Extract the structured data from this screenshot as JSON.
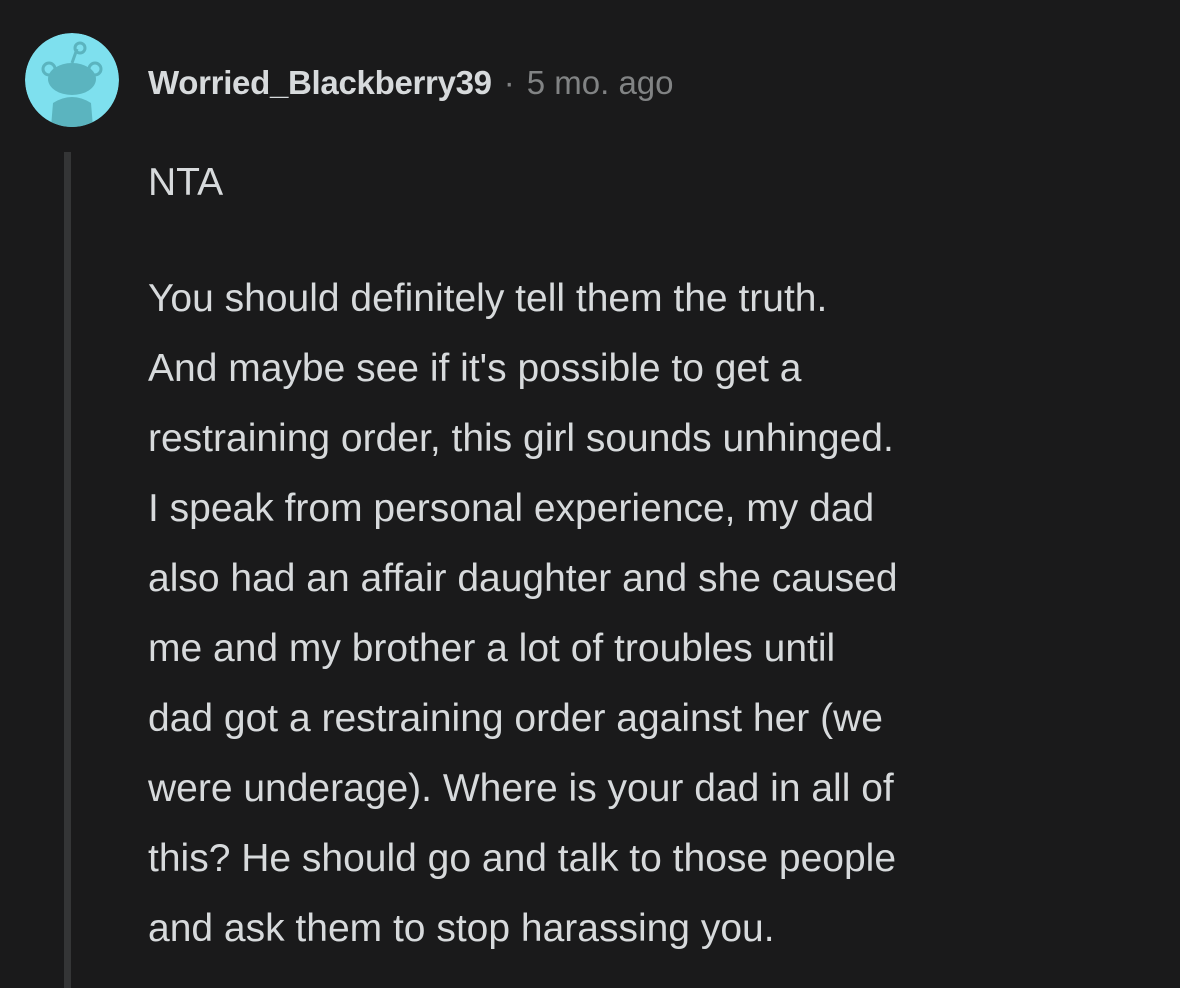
{
  "colors": {
    "background": "#1a1a1b",
    "avatar_bg": "#7ee0ee",
    "avatar_figure": "#5bb4bf",
    "username": "#d7dadc",
    "meta": "#818384",
    "body_text": "#d7dadc",
    "thread_line": "#343536"
  },
  "comment": {
    "avatar_icon": "snoo-avatar-icon",
    "username": "Worried_Blackberry39",
    "separator": "·",
    "timestamp": "5 mo. ago",
    "paragraphs": [
      {
        "lines": [
          "NTA"
        ]
      },
      {
        "lines": [
          "You should definitely tell them the truth.",
          "And maybe see if it's possible to get a",
          "restraining order, this girl sounds unhinged.",
          "I speak from personal experience, my dad",
          "also had an affair daughter and she caused",
          "me and my brother a lot of troubles until",
          "dad got a restraining order against her (we",
          "were underage). Where is your dad in all of",
          "this? He should go and talk to those people",
          "and ask them to stop harassing you."
        ]
      }
    ]
  }
}
